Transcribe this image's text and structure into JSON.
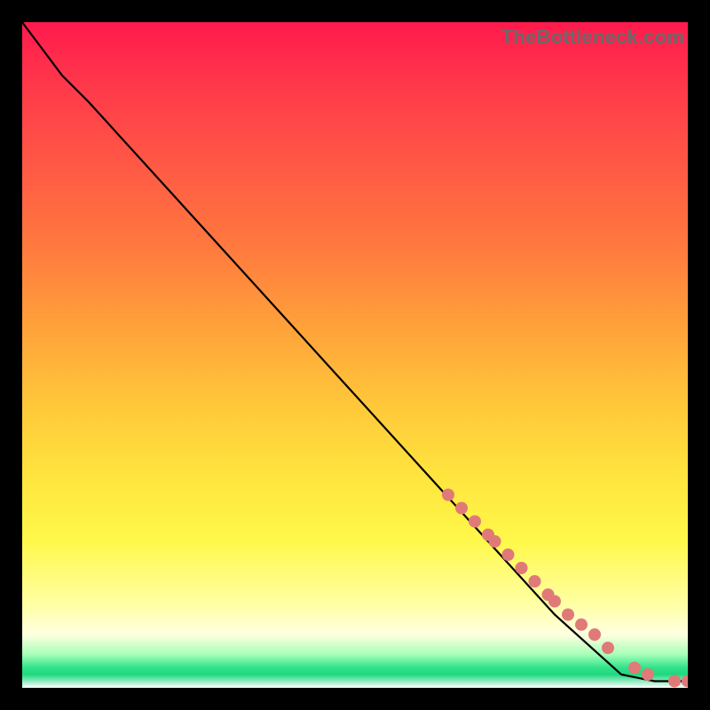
{
  "watermark": "TheBottleneck.com",
  "chart_data": {
    "type": "line",
    "title": "",
    "xlabel": "",
    "ylabel": "",
    "xlim": [
      0,
      100
    ],
    "ylim": [
      0,
      100
    ],
    "grid": false,
    "legend": false,
    "series": [
      {
        "name": "curve",
        "x": [
          0,
          3,
          6,
          10,
          20,
          30,
          40,
          50,
          60,
          70,
          80,
          90,
          95,
          100
        ],
        "y": [
          100,
          96,
          92,
          88,
          77,
          66,
          55,
          44,
          33,
          22,
          11,
          2,
          1,
          1
        ]
      }
    ],
    "markers": {
      "name": "highlighted-points",
      "color": "#e07a78",
      "x": [
        64,
        66,
        68,
        70,
        71,
        73,
        75,
        77,
        79,
        80,
        82,
        84,
        86,
        88,
        92,
        94,
        98,
        100
      ],
      "y": [
        29,
        27,
        25,
        23,
        22,
        20,
        18,
        16,
        14,
        13,
        11,
        9.5,
        8,
        6,
        3,
        2,
        1,
        1
      ]
    }
  }
}
